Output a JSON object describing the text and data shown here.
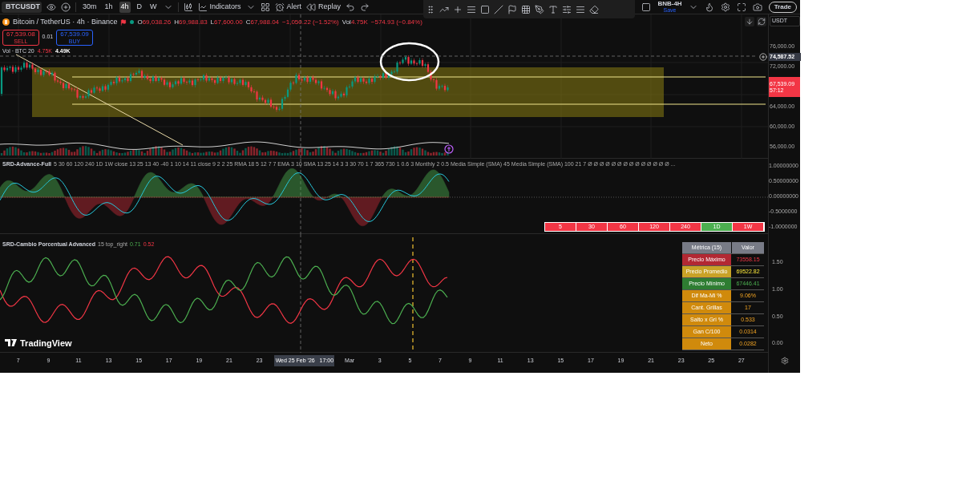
{
  "toolbar": {
    "symbol": "BTCUSDT",
    "intervals": [
      {
        "label": "30m",
        "selected": false
      },
      {
        "label": "1h",
        "selected": false
      },
      {
        "label": "4h",
        "selected": true
      },
      {
        "label": "D",
        "selected": false
      },
      {
        "label": "W",
        "selected": false
      }
    ],
    "indicators": "Indicators",
    "alert": "Alert",
    "replay": "Replay",
    "layout_name": "BNB-4H",
    "layout_status": "Save",
    "trade": "Trade"
  },
  "legend": {
    "title": "Bitcoin / TetherUS · 4h · Binance",
    "ohlc": [
      {
        "label": "O",
        "value": "69,038.26"
      },
      {
        "label": "H",
        "value": "69,988.83"
      },
      {
        "label": "L",
        "value": "67,600.00"
      },
      {
        "label": "C",
        "value": "67,988.04"
      }
    ],
    "change": "−1,050.22 (−1.52%)",
    "vol_label": "Vol",
    "vol": "4.75K",
    "vol_change": "−574.93 (−0.84%)"
  },
  "sell": {
    "price": "67,539.08",
    "label": "SELL"
  },
  "spread": "0.01",
  "buy": {
    "price": "67,539.09",
    "label": "BUY"
  },
  "volume_legend": {
    "name": "Vol · BTC",
    "length": "20",
    "value_1": "4.75K",
    "value_2": "4.49K"
  },
  "currency": "USDT",
  "crosshair_price": "74,587.52",
  "price_axis": [
    {
      "kind": "tick",
      "label": "76,000.00"
    },
    {
      "kind": "tick",
      "label": "72,000.00"
    },
    {
      "kind": "last",
      "label": "67,539.09",
      "countdown": "57:12"
    },
    {
      "kind": "tick",
      "label": "64,000.00"
    },
    {
      "kind": "tick",
      "label": "60,000.00"
    },
    {
      "kind": "tick",
      "label": "56,000.00"
    }
  ],
  "oscillator": {
    "title": "SRD-Advance-Full",
    "params": "5 30 60 120 240 1D 1W close 13 25 13 40 -40 1 10 14 11 close 9 2 2 25 RMA 18 5 12 7 7 EMA 3 10 SMA 13 25 14 3 3 30 70 1 7 365 730 1 0.6 3 Monthly 2 0.5 Media Simple (SMA) 45 Media Simple (SMA) 100 21 7  Ø Ø Ø Ø Ø Ø Ø Ø Ø Ø Ø Ø Ø Ø ...",
    "axis": [
      "1.00000000",
      "0.50000000",
      "0.00000000",
      "-0.5000000",
      "-1.0000000"
    ],
    "timeframes": [
      {
        "label": "5",
        "color": "#f23645"
      },
      {
        "label": "30",
        "color": "#f23645"
      },
      {
        "label": "60",
        "color": "#f23645"
      },
      {
        "label": "120",
        "color": "#f23645"
      },
      {
        "label": "240",
        "color": "#f23645"
      },
      {
        "label": "1D",
        "color": "#4caf50"
      },
      {
        "label": "1W",
        "color": "#f23645"
      }
    ]
  },
  "percent_change": {
    "title": "SRD-Cambio Porcentual Advanced",
    "params": "15 top_right",
    "value_1": "0.71",
    "value_2": "0.52",
    "axis": [
      "1.50",
      "1.00",
      "0.50",
      "0.00"
    ],
    "table": {
      "columns": [
        "Métrica (15)",
        "Valor"
      ],
      "rows": [
        {
          "label": "Precio Máximo",
          "value": "73558.15",
          "color": "#b22833"
        },
        {
          "label": "Precio Promedio",
          "value": "69522.82",
          "color": "#c9a227"
        },
        {
          "label": "Precio Mínimo",
          "value": "67446.41",
          "color": "#2e7d32"
        },
        {
          "label": "Dif Ma-Mi %",
          "value": "9.06%",
          "color": "#d08a0c"
        },
        {
          "label": "Cant. Grillas",
          "value": "17",
          "color": "#d08a0c"
        },
        {
          "label": "Salto x Gri %",
          "value": "0.533",
          "color": "#d08a0c"
        },
        {
          "label": "Gan C/100",
          "value": "0.0314",
          "color": "#d08a0c"
        },
        {
          "label": "Neto",
          "value": "0.0282",
          "color": "#d08a0c"
        }
      ]
    }
  },
  "brand": "TradingView",
  "time_axis": [
    {
      "kind": "tick",
      "label": "7"
    },
    {
      "kind": "tick",
      "label": "9"
    },
    {
      "kind": "tick",
      "label": "11"
    },
    {
      "kind": "tick",
      "label": "13"
    },
    {
      "kind": "tick",
      "label": "15"
    },
    {
      "kind": "tick",
      "label": "17"
    },
    {
      "kind": "tick",
      "label": "19"
    },
    {
      "kind": "tick",
      "label": "21"
    },
    {
      "kind": "tick",
      "label": "23"
    },
    {
      "kind": "crosshair",
      "label": "Wed 25 Feb '26   17:00"
    },
    {
      "kind": "tick",
      "label": "Mar"
    },
    {
      "kind": "tick",
      "label": "3"
    },
    {
      "kind": "tick",
      "label": "5"
    },
    {
      "kind": "tick",
      "label": "7"
    },
    {
      "kind": "tick",
      "label": "9"
    },
    {
      "kind": "tick",
      "label": "11"
    },
    {
      "kind": "tick",
      "label": "13"
    },
    {
      "kind": "tick",
      "label": "15"
    },
    {
      "kind": "tick",
      "label": "17"
    },
    {
      "kind": "tick",
      "label": "19"
    },
    {
      "kind": "tick",
      "label": "21"
    },
    {
      "kind": "tick",
      "label": "23"
    },
    {
      "kind": "tick",
      "label": "25"
    },
    {
      "kind": "tick",
      "label": "27"
    }
  ]
}
